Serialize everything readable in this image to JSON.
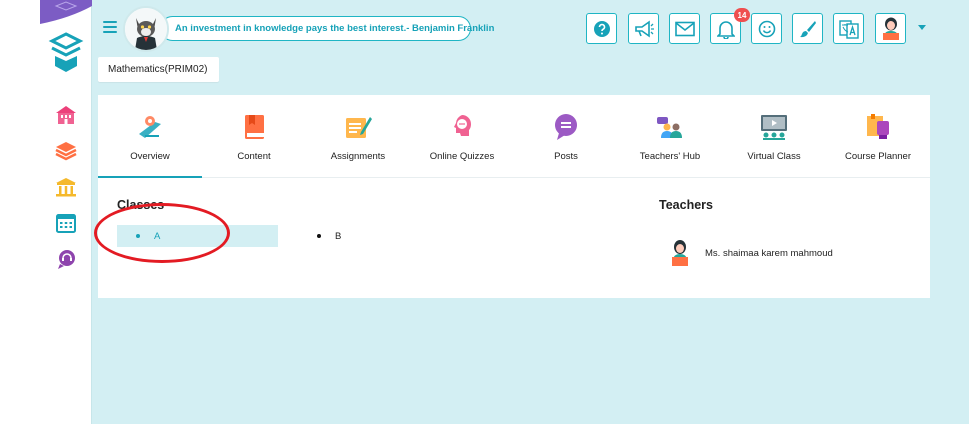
{
  "header": {
    "quote": "An investment in knowledge pays the best interest.- Benjamin Franklin",
    "notification_count": "14",
    "buttons": [
      {
        "name": "help-button",
        "icon": "question-icon"
      },
      {
        "name": "announcements-button",
        "icon": "megaphone-icon"
      },
      {
        "name": "messages-button",
        "icon": "envelope-icon"
      },
      {
        "name": "notifications-button",
        "icon": "bell-icon"
      },
      {
        "name": "mood-button",
        "icon": "smiley-icon"
      },
      {
        "name": "theme-button",
        "icon": "paintbrush-icon"
      },
      {
        "name": "language-button",
        "icon": "translate-icon"
      },
      {
        "name": "profile-button",
        "icon": "user-avatar-icon"
      }
    ]
  },
  "course": {
    "title": "Mathematics(PRIM02)"
  },
  "tabs": [
    {
      "label": "Overview",
      "icon": "overview-icon",
      "active": true
    },
    {
      "label": "Content",
      "icon": "book-icon"
    },
    {
      "label": "Assignments",
      "icon": "assignment-icon"
    },
    {
      "label": "Online Quizzes",
      "icon": "quiz-icon"
    },
    {
      "label": "Posts",
      "icon": "chat-bubble-icon"
    },
    {
      "label": "Teachers' Hub",
      "icon": "teachers-hub-icon"
    },
    {
      "label": "Virtual Class",
      "icon": "virtual-class-icon"
    },
    {
      "label": "Course Planner",
      "icon": "course-planner-icon"
    }
  ],
  "classes": {
    "title": "Classes",
    "items": [
      {
        "label": "A",
        "selected": true
      },
      {
        "label": "B",
        "selected": false
      }
    ]
  },
  "teachers": {
    "title": "Teachers",
    "items": [
      {
        "name": "Ms. shaimaa karem mahmoud"
      }
    ]
  },
  "colors": {
    "accent": "#17a2b8",
    "background": "#d3eff3",
    "annotation": "#e31b23",
    "badge": "#ef4f4f"
  }
}
